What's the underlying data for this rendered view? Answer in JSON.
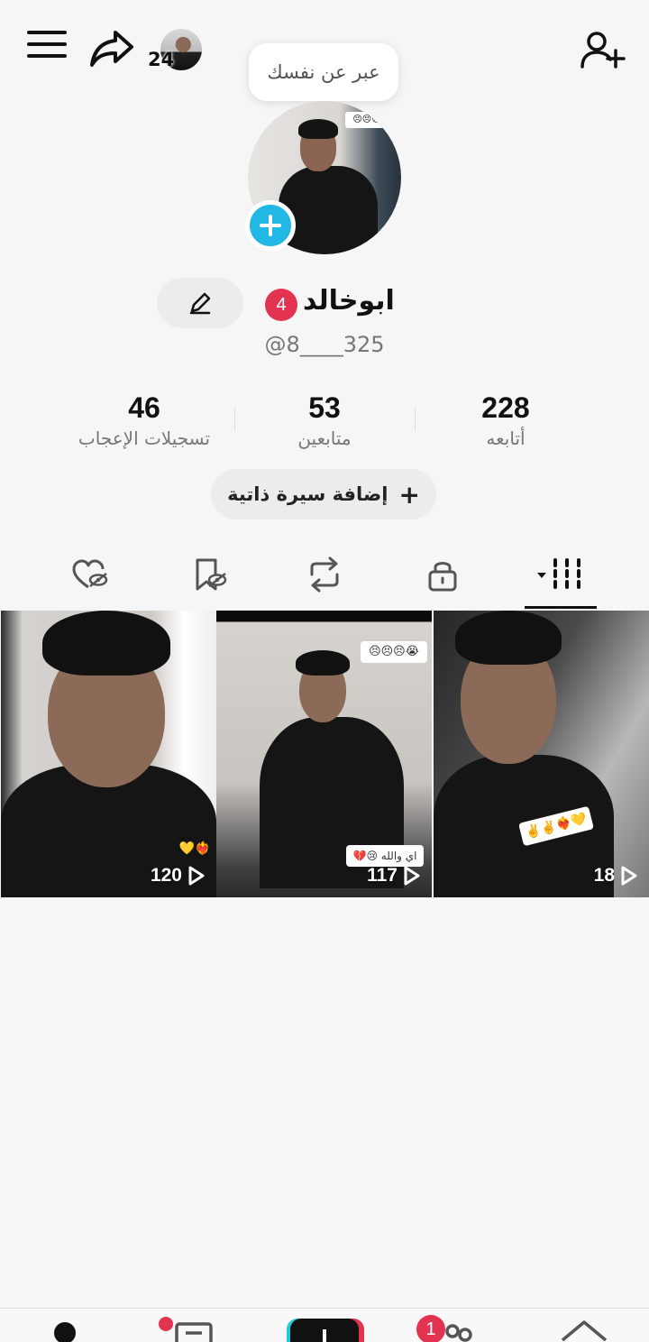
{
  "header": {
    "story_count": "24",
    "bio_prompt": "عبر عن نفسك"
  },
  "profile": {
    "name": "ابوخالد",
    "name_badge": "4",
    "handle": "@8____325"
  },
  "stats": [
    {
      "value": "228",
      "label": "أتابعه"
    },
    {
      "value": "53",
      "label": "متابعين"
    },
    {
      "value": "46",
      "label": "تسجيلات الإعجاب"
    }
  ],
  "bio_button": {
    "label": "إضافة سيرة ذاتية",
    "icon": "plus"
  },
  "tabs": [
    {
      "id": "videos",
      "icon": "grid-bars-icon",
      "active": true
    },
    {
      "id": "private",
      "icon": "lock-icon"
    },
    {
      "id": "reposts",
      "icon": "repost-icon"
    },
    {
      "id": "favorites",
      "icon": "bookmark-hidden-icon"
    },
    {
      "id": "liked",
      "icon": "heart-hidden-icon"
    }
  ],
  "videos": [
    {
      "views": "120",
      "sticker": "💛❤️‍🔥"
    },
    {
      "views": "117",
      "sticker": "اي والله 😢💔",
      "top_sticker": "😣😣😣😭"
    },
    {
      "views": "18",
      "sticker": "✌️✌️❤️‍🔥💛"
    }
  ],
  "avatar_sticker": "😣😣😣",
  "bottom_nav": {
    "inbox_badge": "1",
    "items": [
      "profile",
      "inbox",
      "create",
      "friends",
      "home"
    ]
  },
  "colors": {
    "accent_red": "#e23450",
    "accent_cyan": "#22b8e6",
    "background": "#f6f6f6"
  }
}
